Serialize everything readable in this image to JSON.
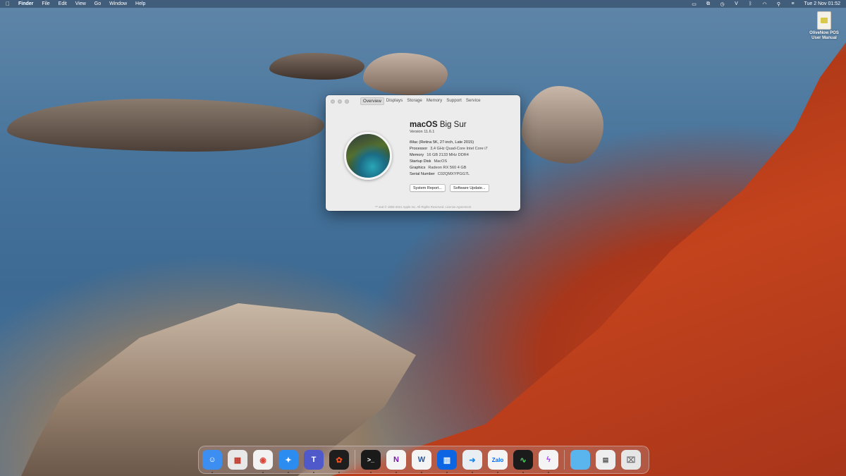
{
  "menubar": {
    "apple": "",
    "app_name": "Finder",
    "menus": [
      "File",
      "Edit",
      "View",
      "Go",
      "Window",
      "Help"
    ],
    "status_icons": [
      "cast-icon",
      "display-icon",
      "history-icon",
      "password-icon",
      "bluetooth-icon",
      "wifi-icon",
      "search-icon",
      "control-center-icon"
    ],
    "clock": "Tue 2 Nov  01:52"
  },
  "desktop": {
    "file_label": "OliveNow POS User Manual"
  },
  "about": {
    "tabs": [
      "Overview",
      "Displays",
      "Storage",
      "Memory",
      "Support",
      "Service"
    ],
    "active_tab": "Overview",
    "os_name_bold": "macOS",
    "os_name_light": " Big Sur",
    "version": "Version 11.6.1",
    "model": "iMac (Retina 5K, 27-inch, Late 2015)",
    "specs": [
      {
        "k": "Processor",
        "v": "3,4 GHz Quad-Core Intel Core i7"
      },
      {
        "k": "Memory",
        "v": "16 GB 2133 MHz DDR4"
      },
      {
        "k": "Startup Disk",
        "v": "MacOS"
      },
      {
        "k": "Graphics",
        "v": "Radeon RX 560 4 GB"
      },
      {
        "k": "Serial Number",
        "v": "C02QMXYPGG7L"
      }
    ],
    "buttons": {
      "system_report": "System Report...",
      "software_update": "Software Update..."
    },
    "footer": "™ and © 1983-2021 Apple Inc. All Rights Reserved. License Agreement"
  },
  "dock": {
    "apps": [
      {
        "name": "finder-icon",
        "color": "#3c8ef0",
        "glyph": "☺"
      },
      {
        "name": "launchpad-icon",
        "color": "#e8e8e8",
        "glyph": "▦"
      },
      {
        "name": "chrome-icon",
        "color": "#f2f2f2",
        "glyph": "◉"
      },
      {
        "name": "safari-icon",
        "color": "#2d8cf0",
        "glyph": "✦"
      },
      {
        "name": "teams-icon",
        "color": "#5059c9",
        "glyph": "T"
      },
      {
        "name": "figma-icon",
        "color": "#1e1e1e",
        "glyph": "✿"
      },
      {
        "name": "terminal-icon",
        "color": "#1a1a1a",
        "glyph": ">_"
      },
      {
        "name": "onenote-icon",
        "color": "#f4f4f4",
        "glyph": "N"
      },
      {
        "name": "word-icon",
        "color": "#f4f4f4",
        "glyph": "W"
      },
      {
        "name": "trello-icon",
        "color": "#0c66e4",
        "glyph": "▥"
      },
      {
        "name": "remote-desktop-icon",
        "color": "#e9eef2",
        "glyph": "➜"
      },
      {
        "name": "zalo-icon",
        "color": "#f4f4f4",
        "glyph": "Zalo"
      },
      {
        "name": "activity-monitor-icon",
        "color": "#1b1b1b",
        "glyph": "∿"
      },
      {
        "name": "messenger-icon",
        "color": "#f4f4f4",
        "glyph": "ϟ"
      }
    ],
    "stack": [
      {
        "name": "folder-icon",
        "color": "#5ab4ee",
        "glyph": ""
      },
      {
        "name": "document-icon",
        "color": "#eeeeee",
        "glyph": ""
      },
      {
        "name": "trash-icon",
        "color": "#e6e6e6",
        "glyph": "🗑"
      }
    ]
  }
}
